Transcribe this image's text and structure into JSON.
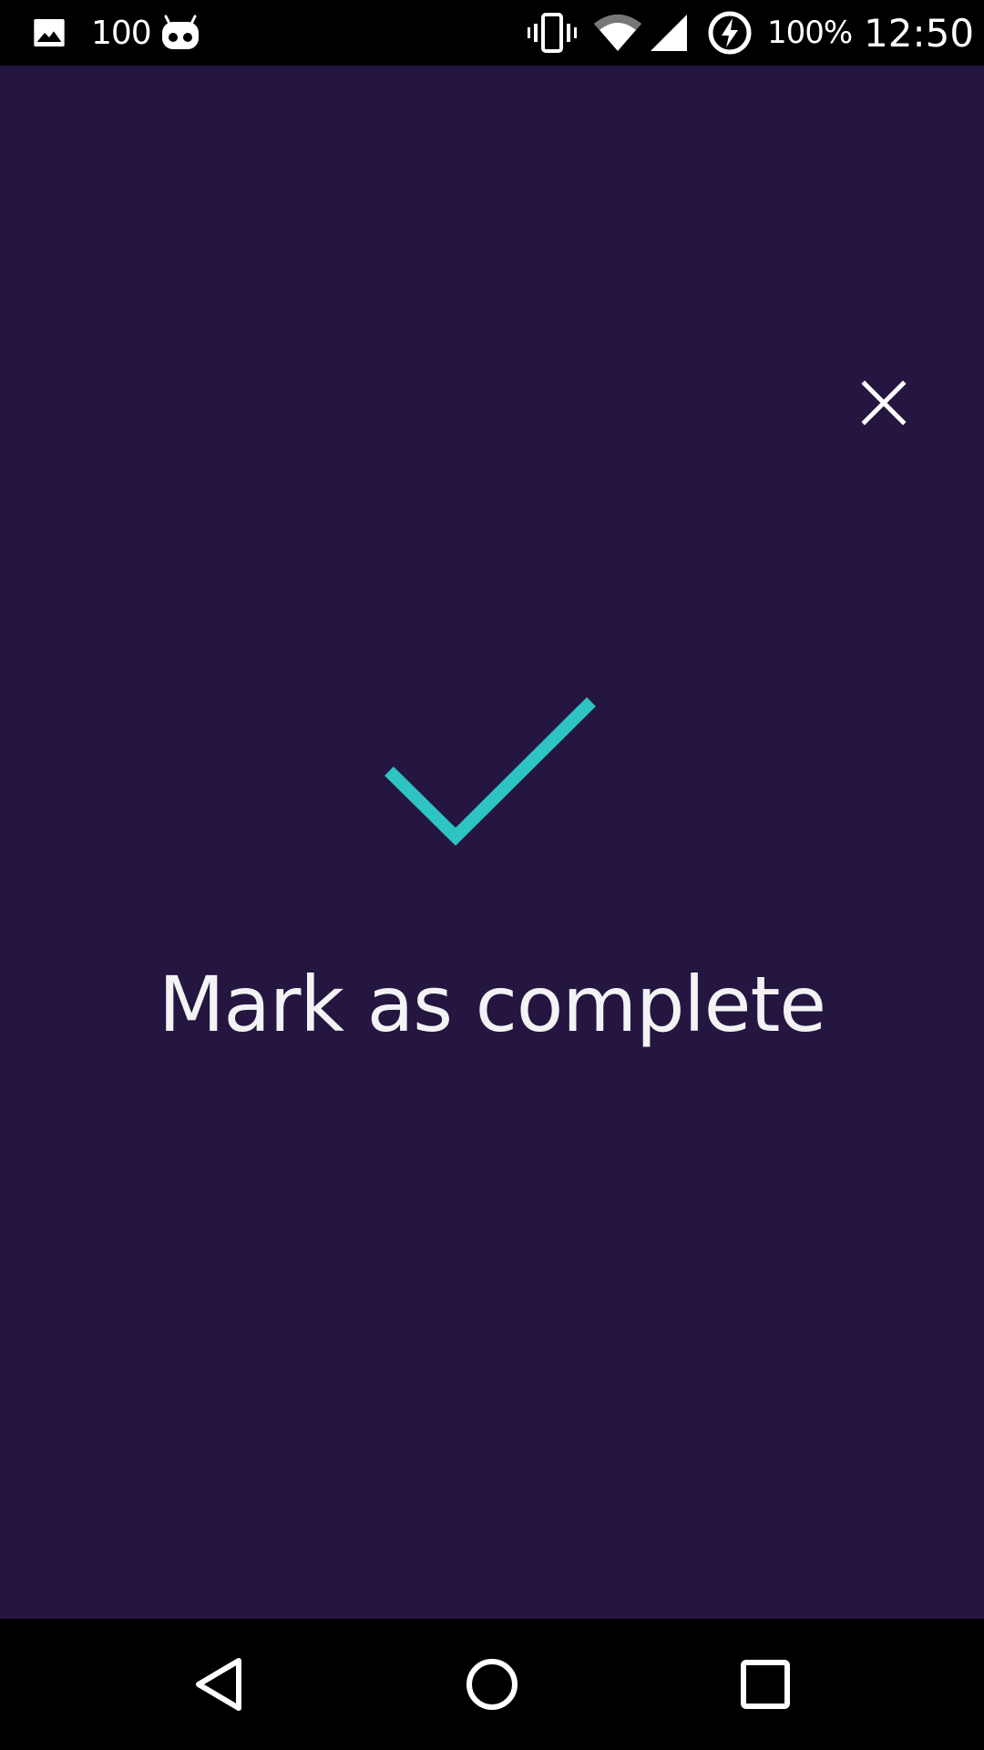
{
  "status_bar": {
    "notification_count": "100",
    "battery_percent": "100%",
    "time": "12:50",
    "icons": [
      "image-icon",
      "cyanogen-icon",
      "vibrate-icon",
      "wifi-icon",
      "signal-icon",
      "battery-charging-icon"
    ]
  },
  "main": {
    "title": "Mark as complete",
    "check_color": "#2ec4c2",
    "background_color": "#241641",
    "close_icon": "close-icon"
  },
  "nav_bar": {
    "buttons": [
      "back-icon",
      "home-icon",
      "recents-icon"
    ]
  }
}
